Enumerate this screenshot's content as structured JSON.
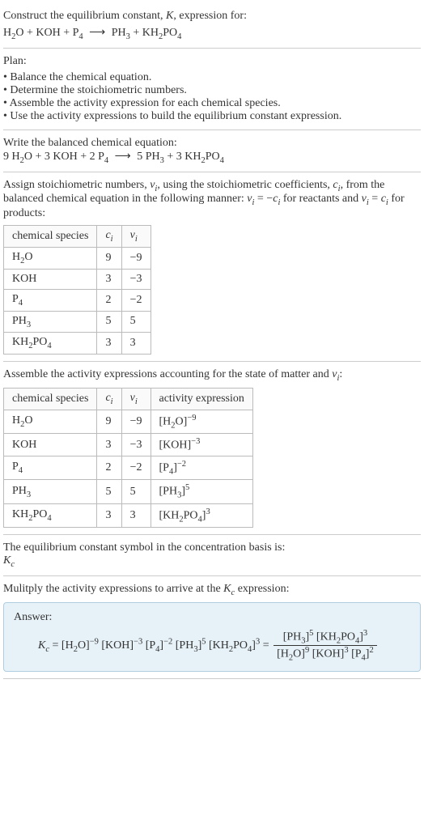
{
  "prompt_line1": "Construct the equilibrium constant, ",
  "prompt_K": "K",
  "prompt_line1b": ", expression for:",
  "unbalanced_eq_html": "H<span class='sub'>2</span>O + KOH + P<span class='sub'>4</span> <span class='arrow'>⟶</span> PH<span class='sub'>3</span> + KH<span class='sub'>2</span>PO<span class='sub'>4</span>",
  "plan_label": "Plan:",
  "plan_items": [
    "Balance the chemical equation.",
    "Determine the stoichiometric numbers.",
    "Assemble the activity expression for each chemical species.",
    "Use the activity expressions to build the equilibrium constant expression."
  ],
  "balanced_label": "Write the balanced chemical equation:",
  "balanced_eq_html": "9 H<span class='sub'>2</span>O + 3 KOH + 2 P<span class='sub'>4</span> <span class='arrow'>⟶</span> 5 PH<span class='sub'>3</span> + 3 KH<span class='sub'>2</span>PO<span class='sub'>4</span>",
  "stoich_text_html": "Assign stoichiometric numbers, <span class='ital'>ν<span class='sub'>i</span></span>, using the stoichiometric coefficients, <span class='ital'>c<span class='sub'>i</span></span>, from the balanced chemical equation in the following manner: <span class='ital'>ν<span class='sub'>i</span></span> = −<span class='ital'>c<span class='sub'>i</span></span> for reactants and <span class='ital'>ν<span class='sub'>i</span></span> = <span class='ital'>c<span class='sub'>i</span></span> for products:",
  "table1_headers": {
    "species": "chemical species",
    "ci_html": "<span class='ital'>c<span class='sub'>i</span></span>",
    "vi_html": "<span class='ital'>ν<span class='sub'>i</span></span>"
  },
  "table1_rows": [
    {
      "sp_html": "H<span class='sub'>2</span>O",
      "c": "9",
      "v": "−9"
    },
    {
      "sp_html": "KOH",
      "c": "3",
      "v": "−3"
    },
    {
      "sp_html": "P<span class='sub'>4</span>",
      "c": "2",
      "v": "−2"
    },
    {
      "sp_html": "PH<span class='sub'>3</span>",
      "c": "5",
      "v": "5"
    },
    {
      "sp_html": "KH<span class='sub'>2</span>PO<span class='sub'>4</span>",
      "c": "3",
      "v": "3"
    }
  ],
  "activity_text_html": "Assemble the activity expressions accounting for the state of matter and <span class='ital'>ν<span class='sub'>i</span></span>:",
  "table2_headers": {
    "species": "chemical species",
    "ci_html": "<span class='ital'>c<span class='sub'>i</span></span>",
    "vi_html": "<span class='ital'>ν<span class='sub'>i</span></span>",
    "activity": "activity expression"
  },
  "table2_rows": [
    {
      "sp_html": "H<span class='sub'>2</span>O",
      "c": "9",
      "v": "−9",
      "a_html": "[H<span class='sub'>2</span>O]<span class='sup'>−9</span>"
    },
    {
      "sp_html": "KOH",
      "c": "3",
      "v": "−3",
      "a_html": "[KOH]<span class='sup'>−3</span>"
    },
    {
      "sp_html": "P<span class='sub'>4</span>",
      "c": "2",
      "v": "−2",
      "a_html": "[P<span class='sub'>4</span>]<span class='sup'>−2</span>"
    },
    {
      "sp_html": "PH<span class='sub'>3</span>",
      "c": "5",
      "v": "5",
      "a_html": "[PH<span class='sub'>3</span>]<span class='sup'>5</span>"
    },
    {
      "sp_html": "KH<span class='sub'>2</span>PO<span class='sub'>4</span>",
      "c": "3",
      "v": "3",
      "a_html": "[KH<span class='sub'>2</span>PO<span class='sub'>4</span>]<span class='sup'>3</span>"
    }
  ],
  "kc_symbol_text": "The equilibrium constant symbol in the concentration basis is:",
  "kc_symbol_html": "<span class='ital'>K<span class='sub'>c</span></span>",
  "multiply_text_html": "Mulitply the activity expressions to arrive at the <span class='ital'>K<span class='sub'>c</span></span> expression:",
  "answer_label": "Answer:",
  "answer_lhs_html": "<span class='ital'>K<span class='sub'>c</span></span> = [H<span class='sub'>2</span>O]<span class='sup'>−9</span> [KOH]<span class='sup'>−3</span> [P<span class='sub'>4</span>]<span class='sup'>−2</span> [PH<span class='sub'>3</span>]<span class='sup'>5</span> [KH<span class='sub'>2</span>PO<span class='sub'>4</span>]<span class='sup'>3</span> = ",
  "answer_num_html": "[PH<span class='sub'>3</span>]<span class='sup'>5</span> [KH<span class='sub'>2</span>PO<span class='sub'>4</span>]<span class='sup'>3</span>",
  "answer_den_html": "[H<span class='sub'>2</span>O]<span class='sup'>9</span> [KOH]<span class='sup'>3</span> [P<span class='sub'>4</span>]<span class='sup'>2</span>"
}
